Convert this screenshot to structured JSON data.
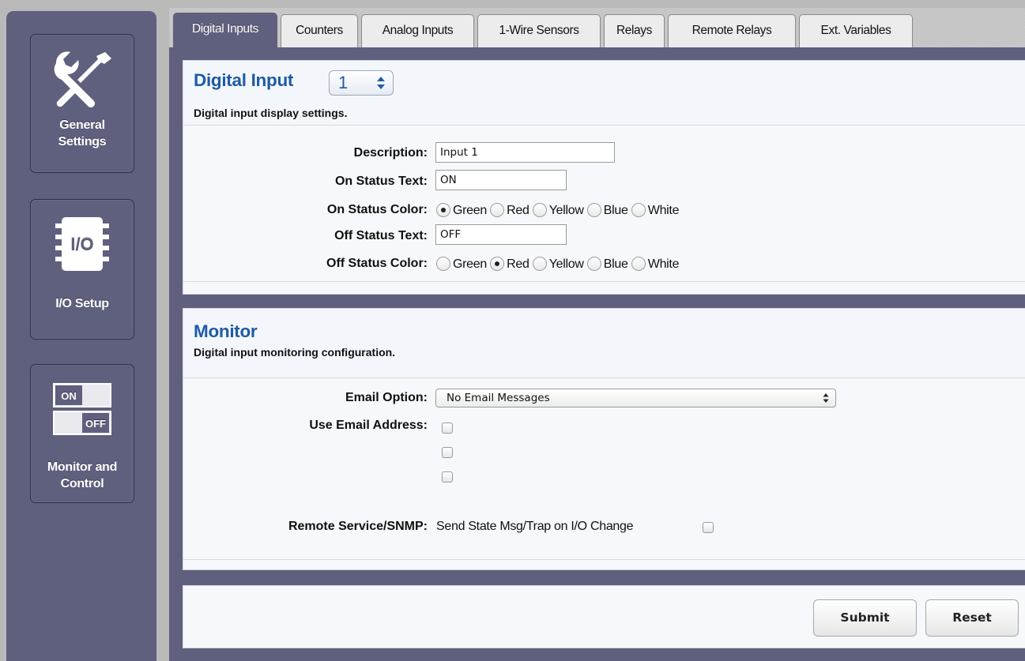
{
  "sidebar": {
    "items": [
      {
        "label": "General Settings",
        "icon": "wrench-screwdriver-icon"
      },
      {
        "label": "I/O Setup",
        "icon": "io-chip-icon"
      },
      {
        "label": "Monitor and Control",
        "icon": "on-off-switch-icon"
      }
    ],
    "general_line1": "General",
    "general_line2": "Settings",
    "io_chip_text": "I/O",
    "io_label": "I/O Setup",
    "monitor_line1": "Monitor and",
    "monitor_line2": "Control",
    "switch_on": "ON",
    "switch_off": "OFF"
  },
  "tabs": [
    {
      "label": "Digital Inputs",
      "active": true
    },
    {
      "label": "Counters",
      "active": false
    },
    {
      "label": "Analog Inputs",
      "active": false
    },
    {
      "label": "1-Wire Sensors",
      "active": false
    },
    {
      "label": "Relays",
      "active": false
    },
    {
      "label": "Remote Relays",
      "active": false
    },
    {
      "label": "Ext. Variables",
      "active": false
    }
  ],
  "display_panel": {
    "title": "Digital Input",
    "input_number": "1",
    "subtitle": "Digital input display settings.",
    "description_label": "Description:",
    "description_value": "Input 1",
    "on_text_label": "On Status Text:",
    "on_text_value": "ON",
    "on_color_label": "On Status Color:",
    "off_text_label": "Off Status Text:",
    "off_text_value": "OFF",
    "off_color_label": "Off Status Color:",
    "colors": [
      "Green",
      "Red",
      "Yellow",
      "Blue",
      "White"
    ],
    "on_color_selected": "Green",
    "off_color_selected": "Red"
  },
  "monitor_panel": {
    "title": "Monitor",
    "subtitle": "Digital input monitoring configuration.",
    "email_option_label": "Email Option:",
    "email_option_value": "No Email Messages",
    "use_email_label": "Use Email Address:",
    "remote_label": "Remote Service/SNMP:",
    "remote_text": "Send State Msg/Trap on I/O Change"
  },
  "actions": {
    "submit": "Submit",
    "reset": "Reset"
  },
  "colors": {
    "accent_blue": "#1f5aa5",
    "sidebar_bg": "#5f5f7e",
    "tab_bg": "#ececec"
  }
}
